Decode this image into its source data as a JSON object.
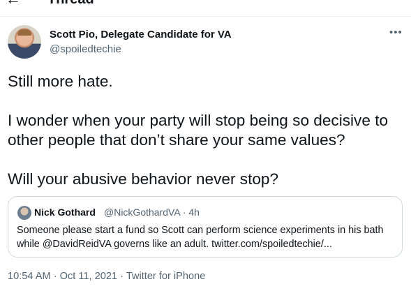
{
  "header": {
    "back_icon": "back-arrow-icon",
    "title": "Thread"
  },
  "tweet": {
    "author_name": "Scott Pio, Delegate Candidate for VA",
    "author_handle": "@spoiledtechie",
    "more_icon": "more-icon",
    "paragraphs": [
      "Still more hate.",
      "I wonder when your party will stop being so decisive to other people that don’t share your same values?",
      "Will your abusive behavior never stop?"
    ],
    "timestamp": "10:54 AM · Oct 11, 2021 · Twitter for iPhone"
  },
  "quoted_tweet": {
    "author_name": "Nick Gothard",
    "author_handle_time": "@NickGothardVA · 4h",
    "text": "Someone please start a fund so Scott can perform science experiments in his bath while @DavidReidVA governs like an adult. twitter.com/spoiledtechie/..."
  }
}
